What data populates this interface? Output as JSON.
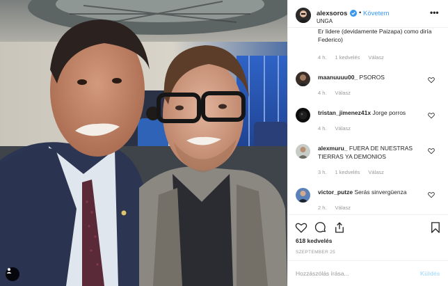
{
  "header": {
    "username": "alexsoros",
    "separator": "•",
    "follow_label": "Követem",
    "location": "UNGA",
    "more_label": "•••"
  },
  "comments": [
    {
      "text": "Er lidere (devidamente Paizapa) como diría Federico)",
      "time": "4 h.",
      "likes": "1 kedvelés",
      "reply": "Válasz"
    },
    {
      "username": "maanuuuu00_",
      "text": "PSOROS",
      "time": "4 h.",
      "reply": "Válasz"
    },
    {
      "username": "tristan_jimenez41x",
      "text": "Jorge porros",
      "time": "4 h.",
      "reply": "Válasz"
    },
    {
      "username": "alexmuru_",
      "text": "FUERA DE NUESTRAS TIERRAS YA DEMONIOS",
      "time": "3 h.",
      "likes": "1 kedvelés",
      "reply": "Válasz"
    },
    {
      "username": "victor_putze",
      "text": "Serás sinvergüenza",
      "time": "2 h.",
      "reply": "Válasz"
    }
  ],
  "post": {
    "likes": "618 kedvelés",
    "date": "SZEPTEMBER 25"
  },
  "composer": {
    "placeholder": "Hozzászólás írása...",
    "post_label": "Küldés"
  },
  "colors": {
    "accent": "#3897f0",
    "verified": "#3897f0",
    "muted_text": "#999999",
    "post_disabled": "#b2dffc"
  },
  "icons": {
    "verified": "verified-badge-icon",
    "heart": "heart-icon",
    "comment": "comment-bubble-icon",
    "share": "share-icon",
    "save": "bookmark-icon",
    "user_tag": "user-tag-icon"
  }
}
